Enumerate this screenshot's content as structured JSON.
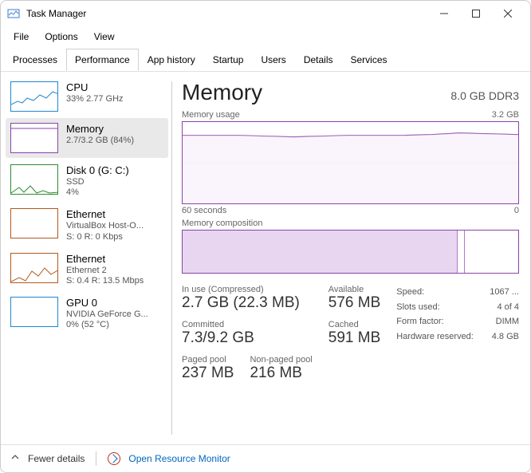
{
  "window": {
    "title": "Task Manager"
  },
  "menu": {
    "file": "File",
    "options": "Options",
    "view": "View"
  },
  "tabs": {
    "processes": "Processes",
    "performance": "Performance",
    "app_history": "App history",
    "startup": "Startup",
    "users": "Users",
    "details": "Details",
    "services": "Services"
  },
  "left": {
    "cpu": {
      "name": "CPU",
      "sub": "33%  2.77 GHz"
    },
    "memory": {
      "name": "Memory",
      "sub": "2.7/3.2 GB (84%)"
    },
    "disk": {
      "name": "Disk 0 (G: C:)",
      "sub": "SSD",
      "sub2": "4%"
    },
    "eth1": {
      "name": "Ethernet",
      "sub": "VirtualBox Host-O...",
      "sub2": "S: 0 R: 0 Kbps"
    },
    "eth2": {
      "name": "Ethernet",
      "sub": "Ethernet 2",
      "sub2": "S: 0.4 R: 13.5 Mbps"
    },
    "gpu": {
      "name": "GPU 0",
      "sub": "NVIDIA GeForce G...",
      "sub2": "0%  (52 °C)"
    }
  },
  "right": {
    "title": "Memory",
    "total": "8.0 GB DDR3",
    "usage_label": "Memory usage",
    "usage_max": "3.2 GB",
    "axis_left": "60 seconds",
    "axis_right": "0",
    "comp_label": "Memory composition",
    "stats": {
      "inuse_label": "In use (Compressed)",
      "inuse": "2.7 GB (22.3 MB)",
      "avail_label": "Available",
      "avail": "576 MB",
      "committed_label": "Committed",
      "committed": "7.3/9.2 GB",
      "cached_label": "Cached",
      "cached": "591 MB",
      "paged_label": "Paged pool",
      "paged": "237 MB",
      "nonpaged_label": "Non-paged pool",
      "nonpaged": "216 MB"
    },
    "kv": {
      "speed_l": "Speed:",
      "speed_v": "1067 ...",
      "slots_l": "Slots used:",
      "slots_v": "4 of 4",
      "form_l": "Form factor:",
      "form_v": "DIMM",
      "hw_l": "Hardware reserved:",
      "hw_v": "4.8 GB"
    }
  },
  "footer": {
    "fewer": "Fewer details",
    "rm": "Open Resource Monitor"
  },
  "chart_data": {
    "type": "line",
    "title": "Memory usage",
    "xlabel": "60 seconds → 0",
    "ylabel": "GB",
    "ylim": [
      0,
      3.2
    ],
    "x": [
      0,
      5,
      10,
      15,
      20,
      25,
      30,
      35,
      40,
      45,
      50,
      55,
      60
    ],
    "values": [
      2.7,
      2.7,
      2.7,
      2.68,
      2.66,
      2.68,
      2.7,
      2.7,
      2.7,
      2.72,
      2.76,
      2.74,
      2.72
    ],
    "composition": {
      "in_use_pct": 82,
      "modified_pct": 2,
      "standby_free_pct": 16
    }
  }
}
